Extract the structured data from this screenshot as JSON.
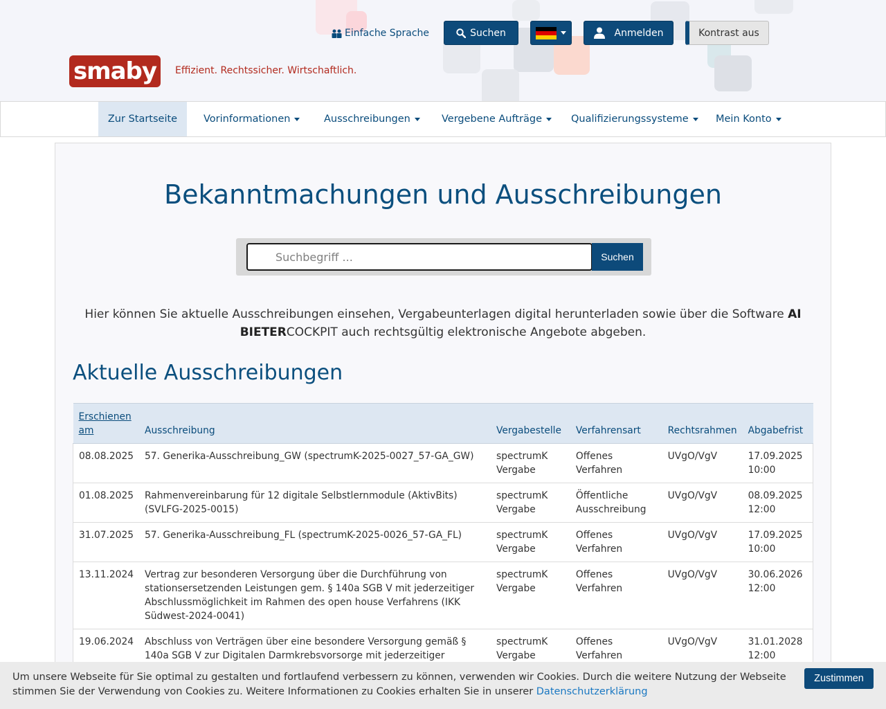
{
  "header": {
    "easy_language_label": "Einfache Sprache",
    "easy_language_icon": "people-icon",
    "search_label": "Suchen",
    "search_icon": "search-icon",
    "language_flag": "german-flag-icon",
    "login_label": "Anmelden",
    "login_icon": "user-icon",
    "contrast_label": "Kontrast aus",
    "logo_text": "smaby",
    "tagline": "Effizient. Rechtssicher. Wirtschaftlich."
  },
  "nav": {
    "items": [
      {
        "label": "Zur Startseite"
      },
      {
        "label": "Vorinformationen"
      },
      {
        "label": "Ausschreibungen"
      },
      {
        "label": "Vergebene Aufträge"
      },
      {
        "label": "Qualifizierungssysteme"
      },
      {
        "label": "Mein Konto"
      }
    ]
  },
  "main": {
    "title": "Bekanntmachungen und Ausschreibungen",
    "search": {
      "placeholder": "Suchbegriff ...",
      "button_label": "Suchen"
    },
    "intro_part1": "Hier können Sie aktuelle Ausschreibungen einsehen, Vergabeunterlagen digital herunterladen sowie über die Software ",
    "intro_bold": "AI BIETER",
    "intro_part2": "COCKPIT auch rechtsgültig elektronische Angebote abgeben.",
    "section_title": "Aktuelle Ausschreibungen",
    "table": {
      "headers": [
        "Erschienen am",
        "Ausschreibung",
        "Vergabestelle",
        "Verfahrensart",
        "Rechtsrahmen",
        "Abgabefrist"
      ],
      "rows": [
        [
          "08.08.2025",
          "57. Generika-Ausschreibung_GW (spectrumK-2025-0027_57-GA_GW)",
          "spectrumK Vergabe",
          "Offenes Verfahren",
          "UVgO/VgV",
          "17.09.2025 10:00"
        ],
        [
          "01.08.2025",
          "Rahmenvereinbarung für 12 digitale Selbstlernmodule (AktivBits) (SVLFG-2025-0015)",
          "spectrumK Vergabe",
          "Öffentliche Ausschreibung",
          "UVgO/VgV",
          "08.09.2025 12:00"
        ],
        [
          "31.07.2025",
          "57. Generika-Ausschreibung_FL (spectrumK-2025-0026_57-GA_FL)",
          "spectrumK Vergabe",
          "Offenes Verfahren",
          "UVgO/VgV",
          "17.09.2025 10:00"
        ],
        [
          "13.11.2024",
          "Vertrag zur besonderen Versorgung über die Durchführung von stationsersetzenden Leistungen gem. § 140a SGB V mit jederzeitiger Abschlussmöglichkeit im Rahmen des open house Verfahrens (IKK Südwest-2024-0041)",
          "spectrumK Vergabe",
          "Offenes Verfahren",
          "UVgO/VgV",
          "30.06.2026 12:00"
        ],
        [
          "19.06.2024",
          "Abschluss von Verträgen über eine besondere Versorgung gemäß § 140a SGB V zur Digitalen Darmkrebsvorsorge mit jederzeitiger",
          "spectrumK Vergabe",
          "Offenes Verfahren",
          "UVgO/VgV",
          "31.01.2028 12:00"
        ]
      ]
    }
  },
  "cookie": {
    "text": "Um unsere Webseite für Sie optimal zu gestalten und fortlaufend verbessern zu können, verwenden wir Cookies. Durch die weitere Nutzung der Webseite stimmen Sie der Verwendung von Cookies zu. Weitere Informationen zu Cookies erhalten Sie in unserer ",
    "link_label": "Datenschutzerklärung",
    "button_label": "Zustimmen"
  },
  "colors": {
    "brand_red": "#b22a1e",
    "primary_blue": "#0d4a7a",
    "nav_active_bg": "#dde7f2"
  }
}
